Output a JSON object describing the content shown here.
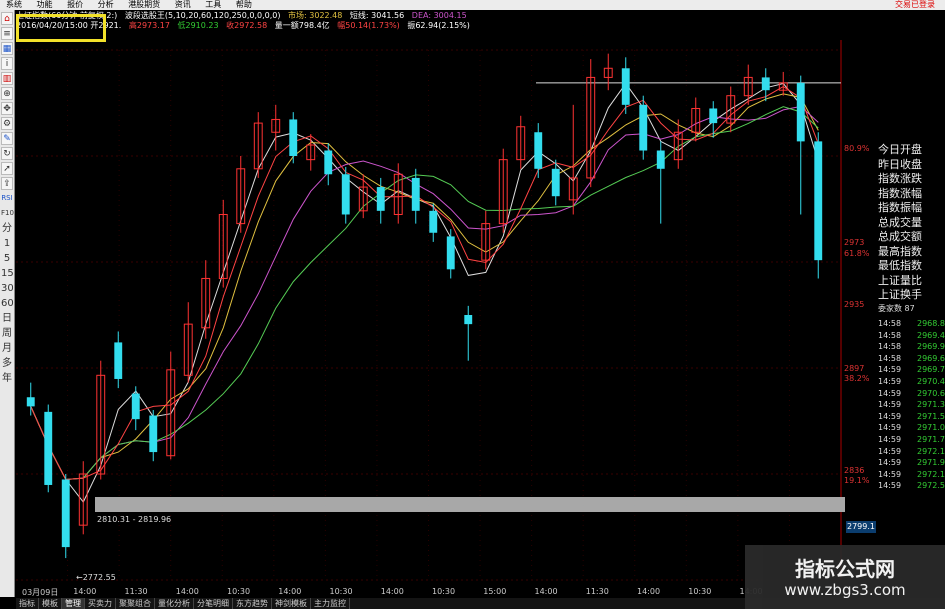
{
  "menu": [
    "系统",
    "功能",
    "报价",
    "分析",
    "港股期货",
    "资讯",
    "工具",
    "帮助"
  ],
  "login_status": "交易已登录",
  "toolbar": {
    "icons": [
      "home-icon",
      "list-icon",
      "grid-icon",
      "info-icon",
      "chart-icon",
      "zoom-icon",
      "pan-icon",
      "settings-icon",
      "draw-icon",
      "refresh-icon",
      "cursor-icon",
      "export-icon"
    ],
    "labels": [
      "RSI",
      "F10",
      "分",
      "1",
      "5",
      "15",
      "30",
      "60",
      "日",
      "周",
      "月",
      "多",
      "年"
    ]
  },
  "info": {
    "line1": [
      "上证指数(60分钟 前复权 2:)",
      "波段选股王(5,10,20,60,120,250,0,0,0,0)",
      "市场: 3022.48",
      "短线: 3041.56",
      "DEA: 3004.15"
    ],
    "line2": [
      "2016/04/20/15:00 开2921.",
      "高2973.17",
      "低2910.23",
      "收2972.58",
      "量一额798.4亿",
      "幅50.14(1.73%)",
      "振62.94(2.15%)"
    ]
  },
  "price_labels": [
    {
      "value": "80.9%"
    },
    {
      "value": "2973"
    },
    {
      "value": "61.8%"
    },
    {
      "value": "2935"
    },
    {
      "value": "2897"
    },
    {
      "value": "38.2%"
    },
    {
      "value": "2836"
    },
    {
      "value": "19.1%"
    }
  ],
  "stat_labels": [
    "今日开盘",
    "昨日收盘",
    "指数涨跌",
    "指数涨幅",
    "指数振幅",
    "总成交量",
    "总成交额",
    "最高指数",
    "最低指数",
    "上证量比",
    "上证换手"
  ],
  "tick_header": "委家数 87",
  "ticks": [
    {
      "time": "14:58",
      "value": "2968.8"
    },
    {
      "time": "14:58",
      "value": "2969.4"
    },
    {
      "time": "14:58",
      "value": "2969.9"
    },
    {
      "time": "14:58",
      "value": "2969.6"
    },
    {
      "time": "14:59",
      "value": "2969.7"
    },
    {
      "time": "14:59",
      "value": "2970.4"
    },
    {
      "time": "14:59",
      "value": "2970.6"
    },
    {
      "time": "14:59",
      "value": "2971.3"
    },
    {
      "time": "14:59",
      "value": "2971.5"
    },
    {
      "time": "14:59",
      "value": "2971.0"
    },
    {
      "time": "14:59",
      "value": "2971.7"
    },
    {
      "time": "14:59",
      "value": "2972.1"
    },
    {
      "time": "14:59",
      "value": "2971.9"
    },
    {
      "time": "14:59",
      "value": "2972.1"
    },
    {
      "time": "14:59",
      "value": "2972.5"
    }
  ],
  "range_label": "2810.31 - 2819.96",
  "low_label": "←2772.55",
  "current_price": "2799.1",
  "time_axis": [
    {
      "label": "03月09日"
    },
    {
      "label": "14:00"
    },
    {
      "label": "11:30"
    },
    {
      "label": "14:00"
    },
    {
      "label": "10:30"
    },
    {
      "label": "14:00"
    },
    {
      "label": "10:30"
    },
    {
      "label": "14:00"
    },
    {
      "label": "10:30"
    },
    {
      "label": "15:00"
    },
    {
      "label": "14:00"
    },
    {
      "label": "11:30"
    },
    {
      "label": "14:00"
    },
    {
      "label": "10:30"
    },
    {
      "label": "14:00"
    },
    {
      "label": "10:30"
    }
  ],
  "bottom_tabs": [
    "指标",
    "模板",
    "管理",
    "买卖力",
    "聚聚组合",
    "量化分析",
    "分笔明细",
    "东方趋势",
    "神剑模板",
    "主力监控"
  ],
  "active_tab_index": 2,
  "watermark": {
    "line1": "指标公式网",
    "line2": "www.zbgs3.com"
  },
  "colors": {
    "up": "#ff3333",
    "down": "#33ddee",
    "ma1": "#dddddd",
    "ma2": "#e0c040",
    "ma3": "#cc55cc",
    "ma4": "#55cc55",
    "ma5": "#ff4444"
  },
  "chart_data": {
    "type": "candlestick",
    "ylim": [
      2760,
      3050
    ],
    "candles": [
      {
        "o": 2860,
        "c": 2855,
        "h": 2868,
        "l": 2850
      },
      {
        "o": 2852,
        "c": 2812,
        "h": 2856,
        "l": 2808
      },
      {
        "o": 2815,
        "c": 2778,
        "h": 2818,
        "l": 2772
      },
      {
        "o": 2790,
        "c": 2818,
        "h": 2825,
        "l": 2785
      },
      {
        "o": 2818,
        "c": 2872,
        "h": 2880,
        "l": 2815
      },
      {
        "o": 2890,
        "c": 2870,
        "h": 2896,
        "l": 2865
      },
      {
        "o": 2862,
        "c": 2848,
        "h": 2866,
        "l": 2842
      },
      {
        "o": 2850,
        "c": 2830,
        "h": 2853,
        "l": 2825
      },
      {
        "o": 2828,
        "c": 2875,
        "h": 2885,
        "l": 2826
      },
      {
        "o": 2872,
        "c": 2900,
        "h": 2912,
        "l": 2868
      },
      {
        "o": 2898,
        "c": 2925,
        "h": 2935,
        "l": 2892
      },
      {
        "o": 2925,
        "c": 2960,
        "h": 2968,
        "l": 2920
      },
      {
        "o": 2955,
        "c": 2985,
        "h": 2992,
        "l": 2950
      },
      {
        "o": 2985,
        "c": 3010,
        "h": 3016,
        "l": 2980
      },
      {
        "o": 3005,
        "c": 3012,
        "h": 3020,
        "l": 2995
      },
      {
        "o": 3012,
        "c": 2992,
        "h": 3016,
        "l": 2988
      },
      {
        "o": 2990,
        "c": 2998,
        "h": 3004,
        "l": 2984
      },
      {
        "o": 2995,
        "c": 2982,
        "h": 2999,
        "l": 2976
      },
      {
        "o": 2982,
        "c": 2960,
        "h": 2986,
        "l": 2955
      },
      {
        "o": 2962,
        "c": 2975,
        "h": 2982,
        "l": 2958
      },
      {
        "o": 2975,
        "c": 2962,
        "h": 2980,
        "l": 2955
      },
      {
        "o": 2960,
        "c": 2982,
        "h": 2988,
        "l": 2955
      },
      {
        "o": 2980,
        "c": 2962,
        "h": 2985,
        "l": 2955
      },
      {
        "o": 2962,
        "c": 2950,
        "h": 2966,
        "l": 2945
      },
      {
        "o": 2948,
        "c": 2930,
        "h": 2952,
        "l": 2925
      },
      {
        "o": 2905,
        "c": 2900,
        "h": 2910,
        "l": 2880
      },
      {
        "o": 2935,
        "c": 2955,
        "h": 2962,
        "l": 2930
      },
      {
        "o": 2955,
        "c": 2990,
        "h": 2996,
        "l": 2950
      },
      {
        "o": 2990,
        "c": 3008,
        "h": 3014,
        "l": 2985
      },
      {
        "o": 3005,
        "c": 2985,
        "h": 3010,
        "l": 2980
      },
      {
        "o": 2985,
        "c": 2970,
        "h": 2990,
        "l": 2965
      },
      {
        "o": 2968,
        "c": 2980,
        "h": 3020,
        "l": 2960
      },
      {
        "o": 2980,
        "c": 3035,
        "h": 3045,
        "l": 2975
      },
      {
        "o": 3035,
        "c": 3040,
        "h": 3048,
        "l": 3028
      },
      {
        "o": 3040,
        "c": 3020,
        "h": 3046,
        "l": 3015
      },
      {
        "o": 3020,
        "c": 2995,
        "h": 3025,
        "l": 2990
      },
      {
        "o": 2995,
        "c": 2985,
        "h": 3000,
        "l": 2955
      },
      {
        "o": 2990,
        "c": 3005,
        "h": 3012,
        "l": 2985
      },
      {
        "o": 3005,
        "c": 3018,
        "h": 3024,
        "l": 3000
      },
      {
        "o": 3018,
        "c": 3010,
        "h": 3022,
        "l": 3002
      },
      {
        "o": 3010,
        "c": 3025,
        "h": 3030,
        "l": 3005
      },
      {
        "o": 3025,
        "c": 3035,
        "h": 3042,
        "l": 3020
      },
      {
        "o": 3035,
        "c": 3028,
        "h": 3040,
        "l": 3022
      },
      {
        "o": 3028,
        "c": 3032,
        "h": 3038,
        "l": 3025
      },
      {
        "o": 3032,
        "c": 3000,
        "h": 3036,
        "l": 2960
      },
      {
        "o": 3000,
        "c": 2935,
        "h": 3005,
        "l": 2925
      }
    ]
  }
}
